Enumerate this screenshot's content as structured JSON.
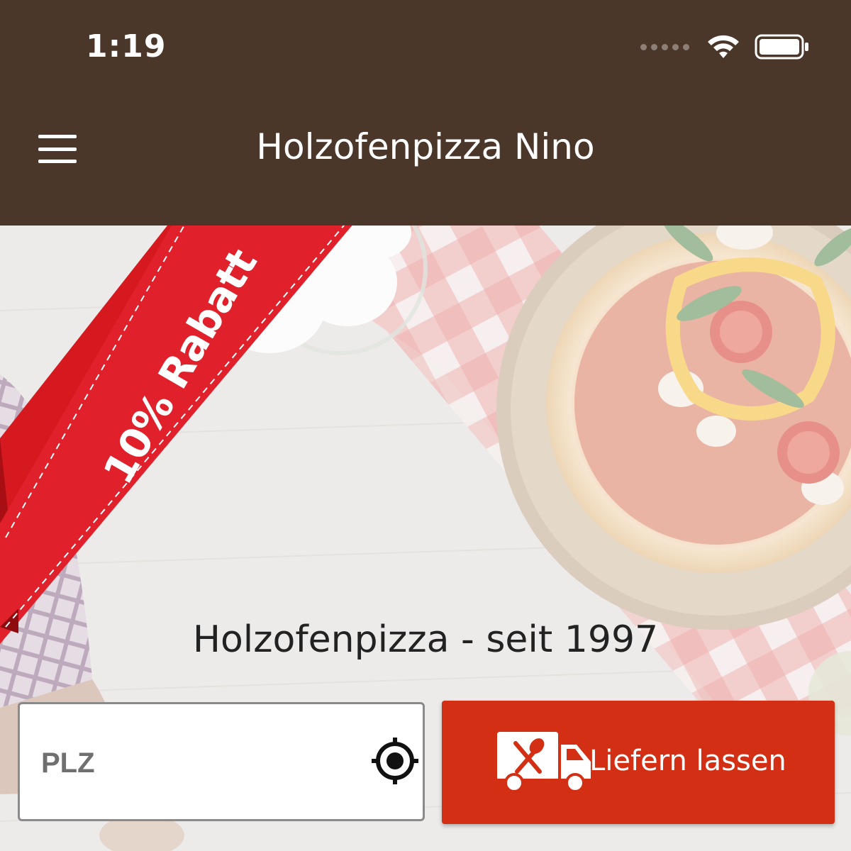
{
  "status_bar": {
    "time": "1:19"
  },
  "header": {
    "title": "Holzofenpizza Nino",
    "background_color": "#4b372a"
  },
  "hero": {
    "promo_ribbon_text": "10% Rabatt",
    "tagline": "Holzofenpizza - seit 1997"
  },
  "search": {
    "placeholder": "PLZ",
    "value": ""
  },
  "deliver_button": {
    "label": "Liefern lassen",
    "color": "#d32f14"
  },
  "icons": {
    "menu": "hamburger-icon",
    "locate": "crosshair-icon",
    "delivery": "delivery-truck-icon",
    "wifi": "wifi-icon",
    "battery": "battery-icon"
  }
}
